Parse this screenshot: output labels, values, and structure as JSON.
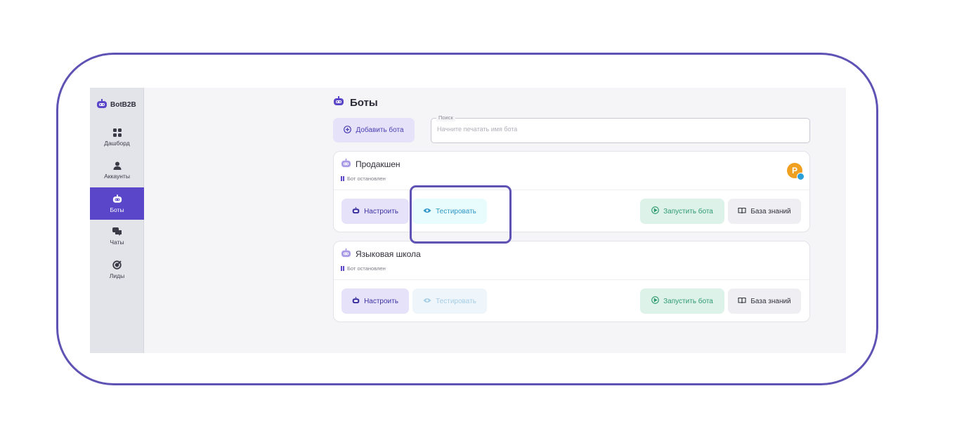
{
  "app": {
    "logo_text": "BotB2B",
    "page_title": "Боты"
  },
  "sidebar": {
    "items": [
      {
        "label": "Дашборд",
        "icon": "dashboard-grid-icon",
        "active": false
      },
      {
        "label": "Аккаунты",
        "icon": "user-icon",
        "active": true
      },
      {
        "label": "Боты",
        "icon": "bot-icon",
        "active": true
      },
      {
        "label": "Чаты",
        "icon": "chat-icon",
        "active": false
      },
      {
        "label": "Лиды",
        "icon": "target-icon",
        "active": false
      }
    ]
  },
  "toolbar": {
    "add_bot_label": "Добавить бота"
  },
  "search": {
    "label": "Поиск",
    "placeholder": "Начните печатать имя бота",
    "value": ""
  },
  "bots": [
    {
      "name": "Продакшен",
      "status": "Бот остановлен",
      "avatar_letter": "P",
      "channel_icon": "telegram-icon",
      "configure_label": "Настроить",
      "test_label": "Тестировать",
      "test_enabled": true,
      "run_label": "Запустить бота",
      "kb_label": "База знаний"
    },
    {
      "name": "Языковая школа",
      "status": "Бот остановлен",
      "configure_label": "Настроить",
      "test_label": "Тестировать",
      "test_enabled": false,
      "run_label": "Запустить бота",
      "kb_label": "База знаний"
    }
  ],
  "colors": {
    "accent": "#5a46c9",
    "frame": "#5f52b5",
    "run": "#2f9a6f",
    "test": "#2f98c7",
    "avatar": "#f0a020",
    "telegram": "#2a9fd8"
  }
}
